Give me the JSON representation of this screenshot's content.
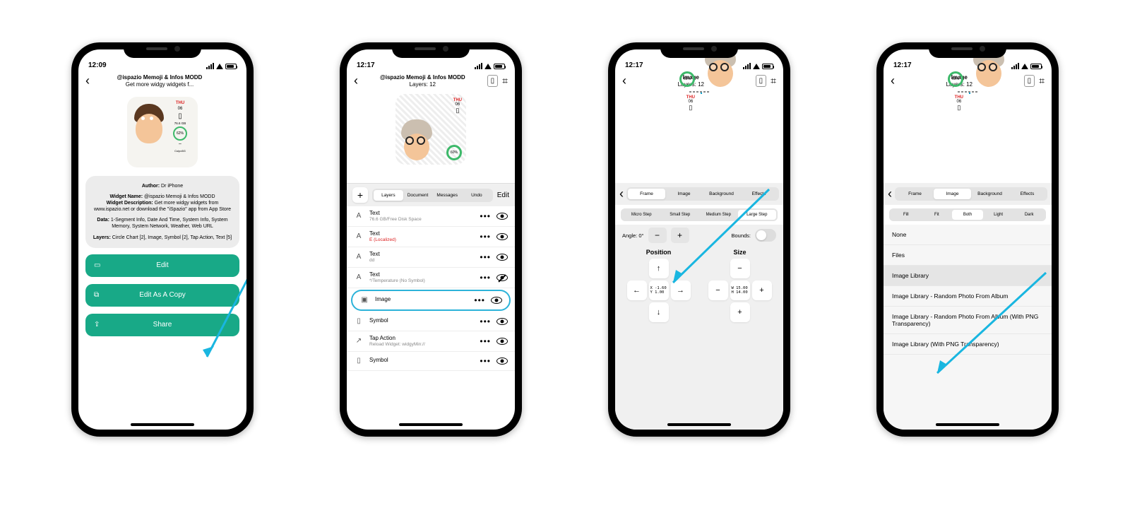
{
  "s1": {
    "time": "12:09",
    "title": "@ispazio Memoji & Infos MODD",
    "subtitle": "Get more widgy widgets f...",
    "preview": {
      "day": "THU",
      "date": "06",
      "storage": "76.6 GB",
      "pct": "62%",
      "wifi": "Cuipo5G"
    },
    "author_lbl": "Author:",
    "author": "Dr iPhone",
    "wname_lbl": "Widget Name:",
    "wname": "@ispazio Memoji & Infos MODD",
    "wdesc_lbl": "Widget Description:",
    "wdesc": "Get more widgy widgets from www.ispazio.net or download the \"iSpazio\" app from App Store",
    "data_lbl": "Data:",
    "data": "1-Segment Info, Date And Time, System Info, System Memory, System Network, Weather, Web URL",
    "layers_lbl": "Layers:",
    "layers": "Circle Chart [2], Image, Symbol [2], Tap Action, Text [5]",
    "btn_edit": "Edit",
    "btn_copy": "Edit As A Copy",
    "btn_share": "Share"
  },
  "s2": {
    "time": "12:17",
    "title": "@ispazio Memoji & Infos MODD",
    "subtitle": "Layers: 12",
    "seg": [
      "Layers",
      "Document",
      "Messages",
      "Undo"
    ],
    "edit": "Edit",
    "preview": {
      "day": "THU",
      "date": "06",
      "pct": "60%"
    },
    "rows": [
      {
        "icon": "A",
        "title": "Text",
        "sub": "76.6 GB/Free Disk Space",
        "red": false,
        "off": false
      },
      {
        "icon": "A",
        "title": "Text",
        "sub": "E (Localized)",
        "red": true,
        "off": false
      },
      {
        "icon": "A",
        "title": "Text",
        "sub": "dd",
        "red": false,
        "off": false
      },
      {
        "icon": "A",
        "title": "Text",
        "sub": "*/Temperature (No Symbol)",
        "red": false,
        "off": true
      },
      {
        "icon": "▣",
        "title": "Image",
        "sub": "",
        "red": false,
        "off": false,
        "hl": true
      },
      {
        "icon": "▯",
        "title": "Symbol",
        "sub": "",
        "red": false,
        "off": false
      },
      {
        "icon": "↗",
        "title": "Tap Action",
        "sub": "Reload Widget: widgyMin://",
        "red": false,
        "off": false
      },
      {
        "icon": "▯",
        "title": "Symbol",
        "sub": "",
        "red": false,
        "off": false
      }
    ]
  },
  "s3": {
    "time": "12:17",
    "title": "Image",
    "subtitle": "Layers: 12",
    "preview": {
      "day": "THU",
      "date": "06",
      "pct": "60%"
    },
    "tabs": [
      "Frame",
      "Image",
      "Background",
      "Effects"
    ],
    "tab_active": 0,
    "steps": [
      "Micro Step",
      "Small Step",
      "Medium Step",
      "Large Step"
    ],
    "angle_lbl": "Angle: 0°",
    "bounds_lbl": "Bounds:",
    "pos_lbl": "Position",
    "size_lbl": "Size",
    "pos_mid": "X -1.60\nY 1.00",
    "size_mid": "W 15.00\nH 14.00"
  },
  "s4": {
    "time": "12:17",
    "title": "Image",
    "subtitle": "Layers: 12",
    "preview": {
      "day": "THU",
      "date": "06",
      "pct": "60%"
    },
    "tabs": [
      "Frame",
      "Image",
      "Background",
      "Effects"
    ],
    "tab_active": 1,
    "modes": [
      "Fill",
      "Fit",
      "Both",
      "Light",
      "Dark"
    ],
    "options": [
      "None",
      "Files",
      "Image Library",
      "Image Library - Random Photo From Album",
      "Image Library - Random Photo From Album (With PNG Transparency)",
      "Image Library (With PNG Transparency)"
    ],
    "opt_hl": 2
  }
}
